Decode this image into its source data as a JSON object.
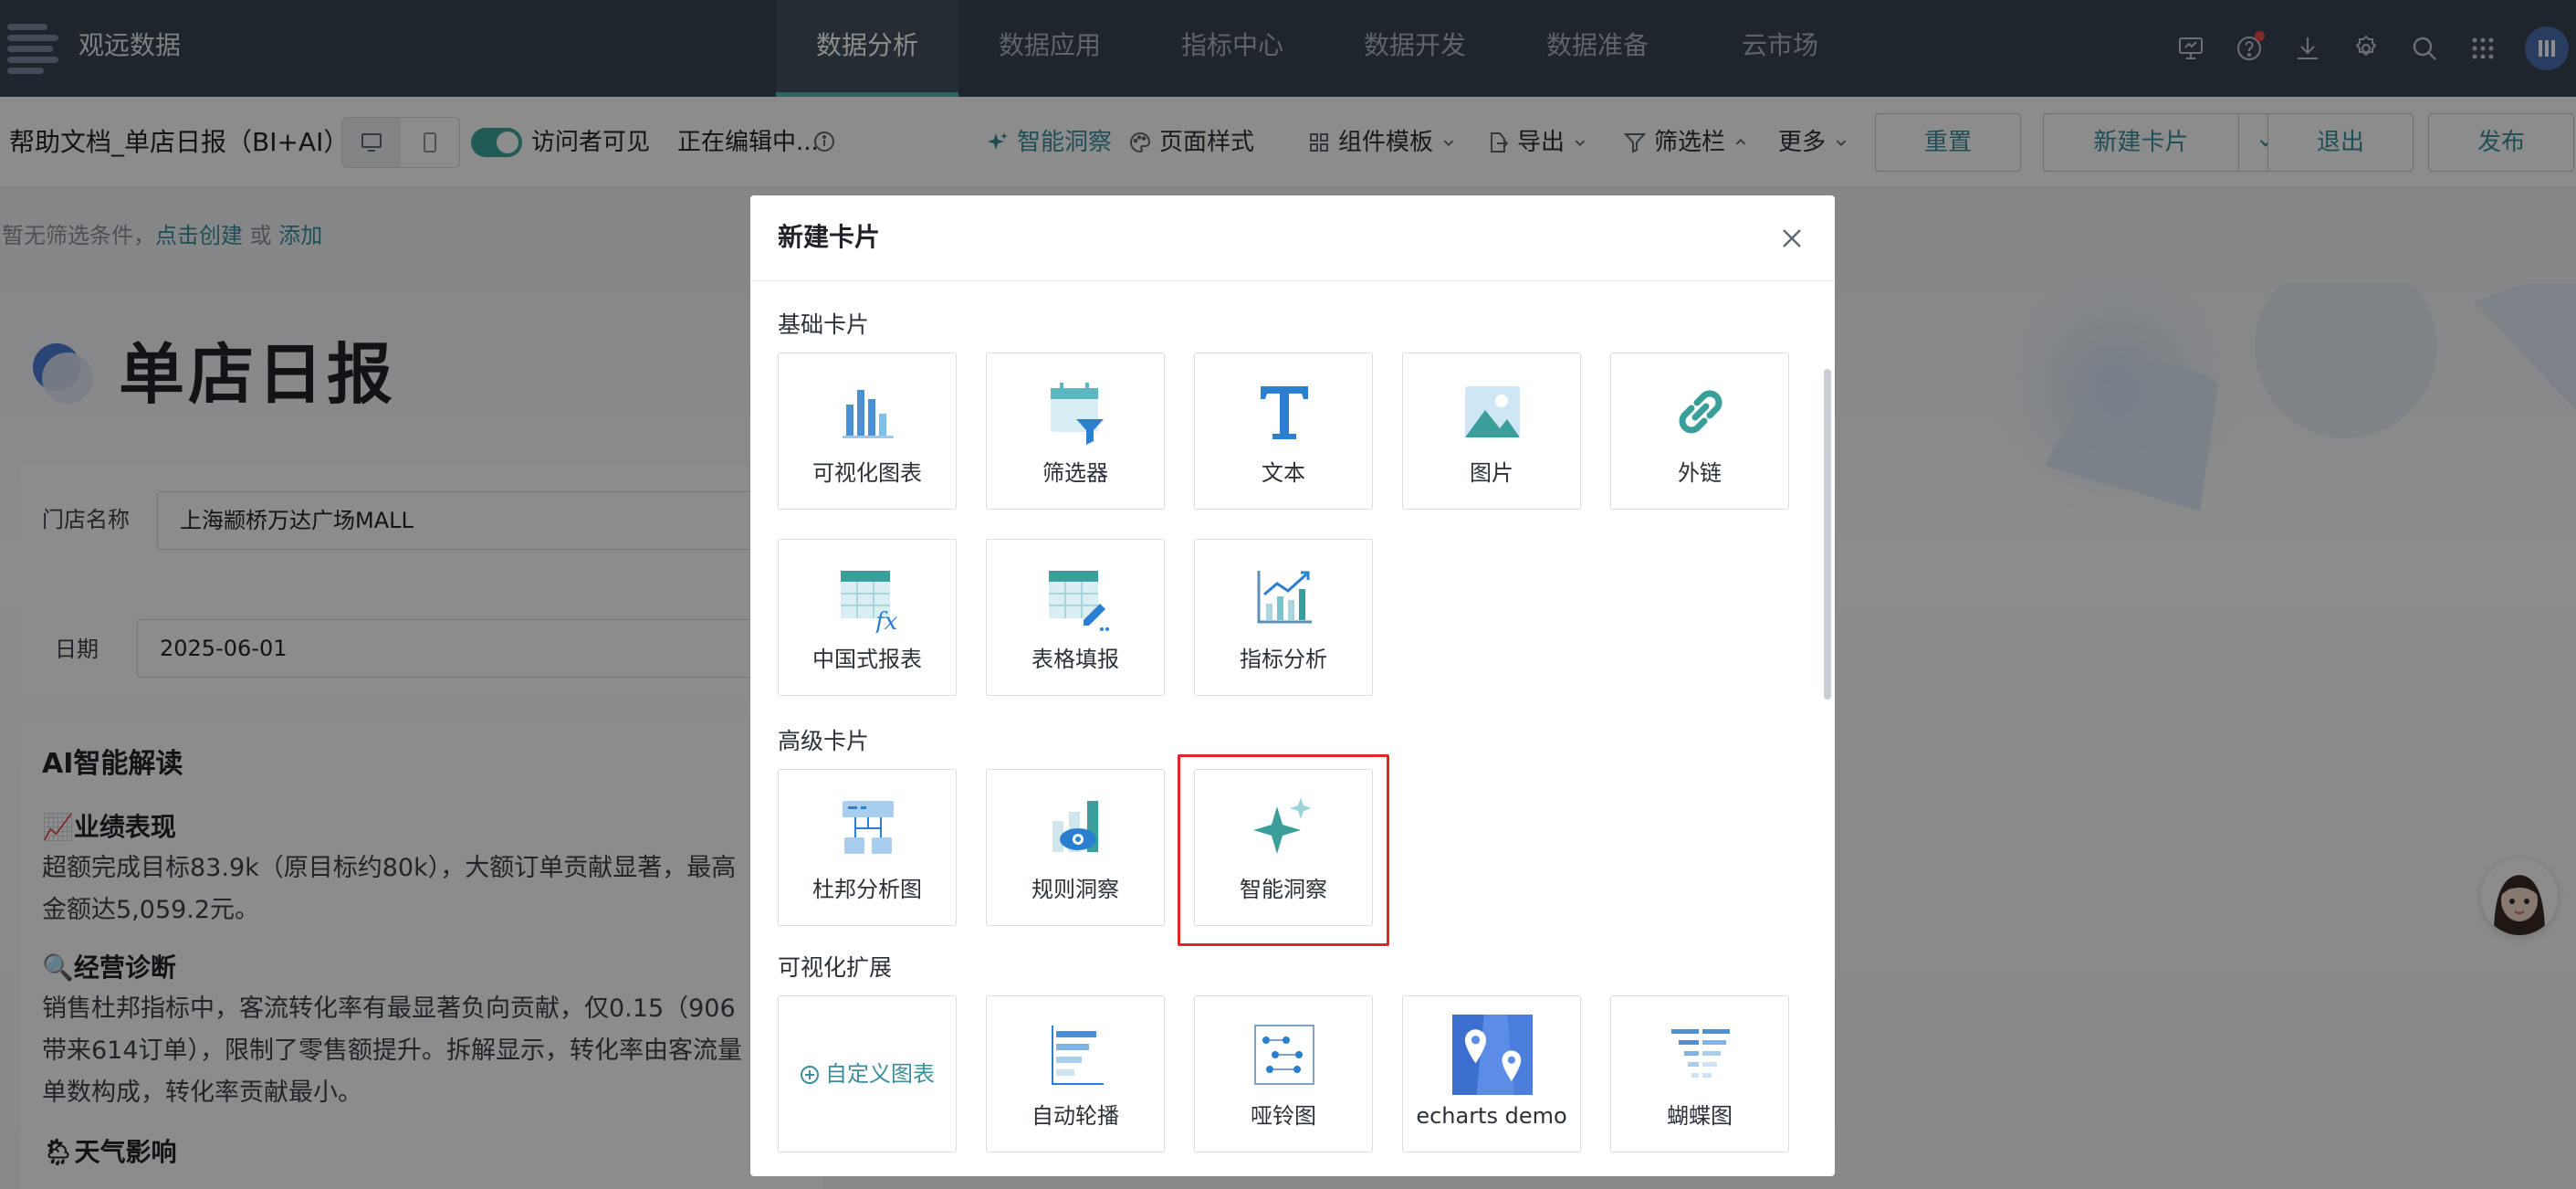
{
  "app": {
    "name": "观远数据"
  },
  "nav": {
    "items": [
      {
        "label": "数据分析",
        "active": true
      },
      {
        "label": "数据应用",
        "active": false
      },
      {
        "label": "指标中心",
        "active": false
      },
      {
        "label": "数据开发",
        "active": false
      },
      {
        "label": "数据准备",
        "active": false
      },
      {
        "label": "云市场",
        "active": false
      }
    ]
  },
  "top_icons": [
    "monitor-icon",
    "help-icon",
    "download-icon",
    "settings-icon",
    "search-icon",
    "apps-grid-icon",
    "user-avatar"
  ],
  "toolbar": {
    "doc_title": "帮助文档_单店日报（BI+AI）",
    "visitor_label": "访问者可见",
    "editing_label": "正在编辑中...",
    "smart_insight": "智能洞察",
    "page_style": "页面样式",
    "component_template": "组件模板",
    "export": "导出",
    "filter_bar": "筛选栏",
    "more": "更多",
    "reset": "重置",
    "new_card": "新建卡片",
    "exit": "退出",
    "publish": "发布"
  },
  "filterbar": {
    "text": "暂无筛选条件，",
    "create": "点击创建",
    "or": "或",
    "add": "添加"
  },
  "dashboard": {
    "title": "单店日报",
    "store_label": "门店名称",
    "store_value": "上海颛桥万达广场MALL",
    "date_label": "日期",
    "date_value": "2025-06-01",
    "ai_title": "AI智能解读",
    "sections": [
      {
        "heading": "📈业绩表现",
        "lines": [
          "超额完成目标83.9k（原目标约80k），大额订单贡献显著，最高",
          "金额达5,059.2元。"
        ]
      },
      {
        "heading": "🔍经营诊断",
        "lines": [
          "销售杜邦指标中，客流转化率有最显著负向贡献，仅0.15（906",
          "带来614订单），限制了零售额提升。拆解显示，转化率由客流量",
          "单数构成，转化率贡献最小。"
        ]
      },
      {
        "heading": "🌦天气影响",
        "lines": []
      }
    ]
  },
  "modal": {
    "title": "新建卡片",
    "sections": [
      {
        "title": "基础卡片",
        "tiles": [
          {
            "label": "可视化图表",
            "icon": "bar-chart-icon"
          },
          {
            "label": "筛选器",
            "icon": "filter-calendar-icon"
          },
          {
            "label": "文本",
            "icon": "text-icon"
          },
          {
            "label": "图片",
            "icon": "image-icon"
          },
          {
            "label": "外链",
            "icon": "link-icon"
          },
          {
            "label": "中国式报表",
            "icon": "formula-table-icon"
          },
          {
            "label": "表格填报",
            "icon": "table-edit-icon"
          },
          {
            "label": "指标分析",
            "icon": "metric-chart-icon"
          }
        ]
      },
      {
        "title": "高级卡片",
        "tiles": [
          {
            "label": "杜邦分析图",
            "icon": "dupont-tree-icon"
          },
          {
            "label": "规则洞察",
            "icon": "rule-insight-icon"
          },
          {
            "label": "智能洞察",
            "icon": "sparkle-icon",
            "highlighted": true
          }
        ]
      },
      {
        "title": "可视化扩展",
        "tiles": [
          {
            "label": "自定义图表",
            "icon": "plus-circle-icon"
          },
          {
            "label": "自动轮播",
            "icon": "carousel-icon"
          },
          {
            "label": "哑铃图",
            "icon": "dumbbell-icon"
          },
          {
            "label": "echarts demo",
            "icon": "map-pin-icon"
          },
          {
            "label": "蝴蝶图",
            "icon": "butterfly-icon"
          }
        ]
      }
    ]
  },
  "colors": {
    "teal": "#3b8f9a",
    "accent_green": "#4fb6b0",
    "highlight_red": "#e0262a",
    "nav_bg": "#3a4452"
  }
}
